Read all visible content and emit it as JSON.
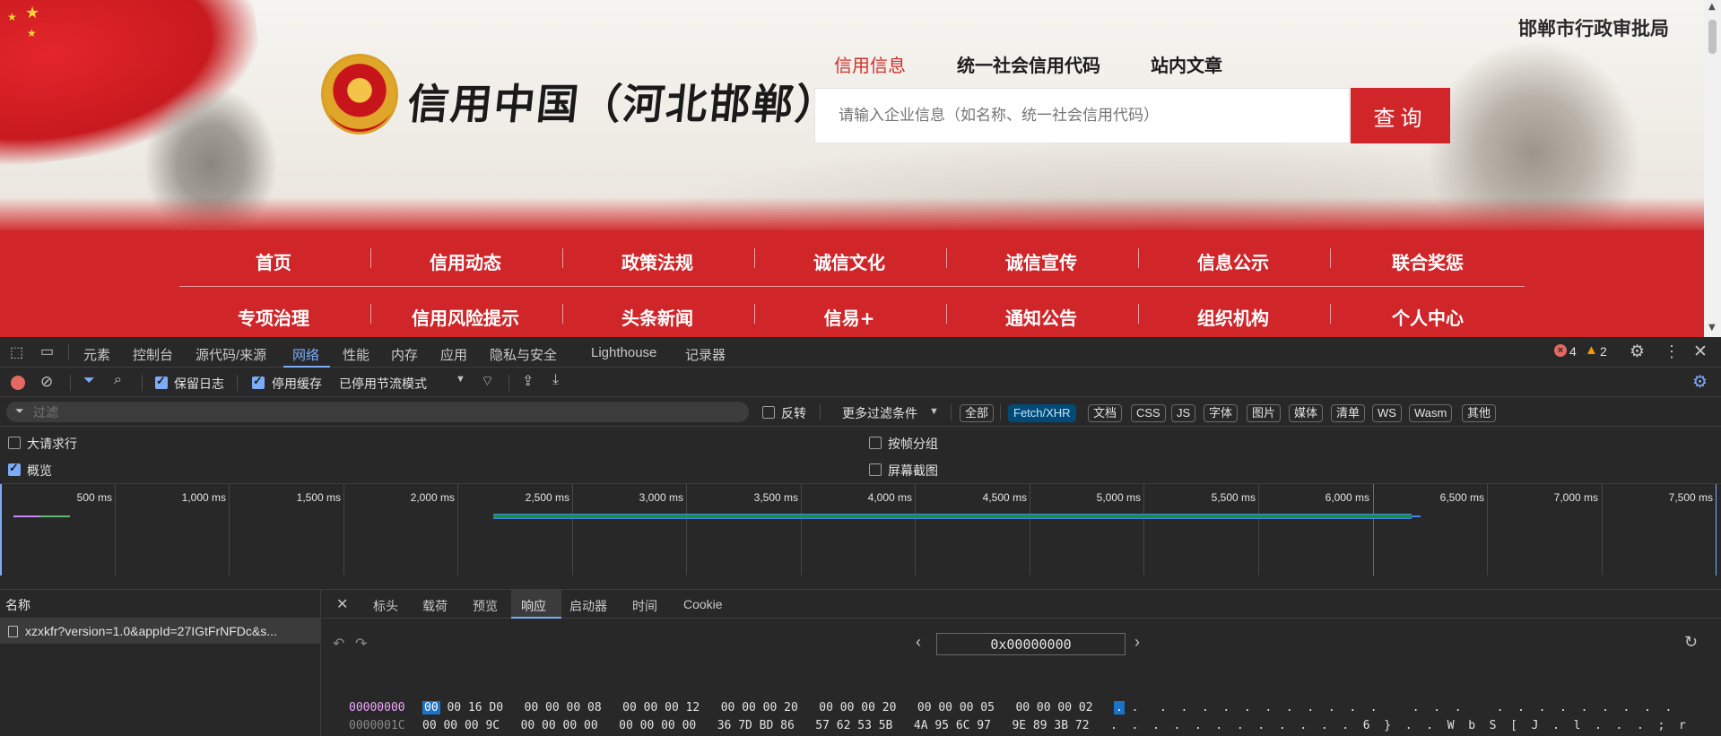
{
  "site": {
    "header": {
      "logo_title": "信用中国（河北邯郸）",
      "bureau": "邯郸市行政审批局",
      "top_links": [
        "信用信息",
        "统一社会信用代码",
        "站内文章"
      ],
      "search_placeholder": "请输入企业信息（如名称、统一社会信用代码）",
      "search_button": "查询"
    },
    "nav_row1": [
      "首页",
      "信用动态",
      "政策法规",
      "诚信文化",
      "诚信宣传",
      "信息公示",
      "联合奖惩"
    ],
    "nav_row2": [
      "专项治理",
      "信用风险提示",
      "头条新闻",
      "信易+",
      "通知公告",
      "组织机构",
      "个人中心"
    ]
  },
  "devtools": {
    "tabs": [
      "元素",
      "控制台",
      "源代码/来源",
      "网络",
      "性能",
      "内存",
      "应用",
      "隐私与安全",
      "Lighthouse",
      "记录器"
    ],
    "active_tab": "网络",
    "errors": "4",
    "warnings": "2",
    "toolbar": {
      "preserve_log": "保留日志",
      "disable_cache": "停用缓存",
      "throttle": "已停用节流模式"
    },
    "filter": {
      "placeholder": "过滤",
      "invert": "反转",
      "more_filters": "更多过滤条件",
      "types": [
        "全部",
        "Fetch/XHR",
        "文档",
        "CSS",
        "JS",
        "字体",
        "图片",
        "媒体",
        "清单",
        "WS",
        "Wasm",
        "其他"
      ],
      "active_type": "Fetch/XHR"
    },
    "options": {
      "big_rows": "大请求行",
      "overview": "概览",
      "group_by_frame": "按帧分组",
      "screenshots": "屏幕截图"
    },
    "timeline_ticks": [
      "500 ms",
      "1,000 ms",
      "1,500 ms",
      "2,000 ms",
      "2,500 ms",
      "3,000 ms",
      "3,500 ms",
      "4,000 ms",
      "4,500 ms",
      "5,000 ms",
      "5,500 ms",
      "6,000 ms",
      "6,500 ms",
      "7,000 ms",
      "7,500 ms"
    ],
    "names_header": "名称",
    "request_name": "xzxkfr?version=1.0&appId=27IGtFrNFDc&s...",
    "detail_tabs": [
      "标头",
      "载荷",
      "预览",
      "响应",
      "启动器",
      "时间",
      "Cookie"
    ],
    "active_detail_tab": "响应",
    "hex": {
      "address": "0x00000000",
      "rows": [
        {
          "offset": "00000000",
          "first_byte": "00",
          "bytes": "00 16 D0   00 00 00 08   00 00 00 12   00 00 00 20   00 00 00 20   00 00 00 05   00 00 00 02",
          "ascii_hi": ".",
          "ascii": " .   .  .  .  .  .  .  .  .  .  .  .     .  .  .     .  .  .  .  .  .  .  .  ."
        },
        {
          "offset": "0000001C",
          "first_byte": "",
          "bytes": "00 00 00 9C   00 00 00 00   00 00 00 00   36 7D BD 86   57 62 53 5B   4A 95 6C 97   9E 89 3B 72",
          "ascii_hi": "",
          "ascii": ".  .  .  .  .  .  .  .  .  .  .  .  6  }  .  .  W  b  S  [  J  .  l  .  .  .  ;  r"
        }
      ]
    }
  }
}
